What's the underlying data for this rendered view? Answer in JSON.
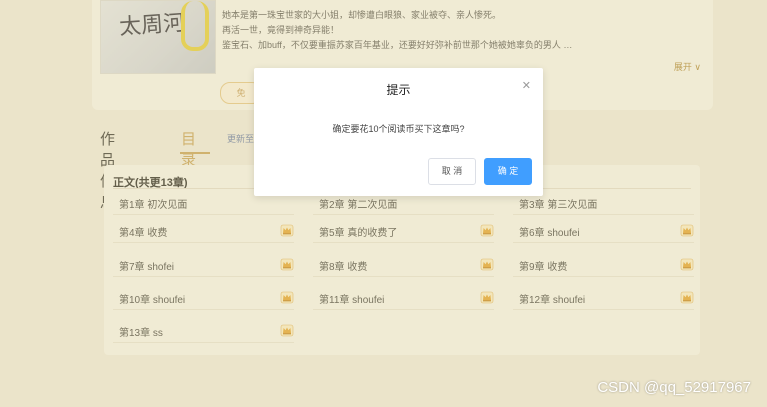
{
  "book": {
    "cover_title": "太周河",
    "description_lines": [
      "她本是第一珠宝世家的大小姐，却惨遭白眼狼、家业被夺、亲人惨死。",
      "再活一世，竟得到神奇异能！",
      "鉴宝石、加buff，不仅要重振苏家百年基业，还要好好弥补前世那个她被她辜负的男人 …"
    ],
    "expand_label": "展开 ∨",
    "free_label": "免"
  },
  "tabs": {
    "info_label": "作品信息",
    "toc_label": "目录",
    "update_label": "更新至"
  },
  "toc": {
    "section_title": "正文(共更13章)",
    "chapters": [
      {
        "label": "第1章 初次见面",
        "locked": false
      },
      {
        "label": "第2章 第二次见面",
        "locked": false
      },
      {
        "label": "第3章 第三次见面",
        "locked": false
      },
      {
        "label": "第4章 收费",
        "locked": true
      },
      {
        "label": "第5章 真的收费了",
        "locked": true
      },
      {
        "label": "第6章 shoufei",
        "locked": true
      },
      {
        "label": "第7章 shofei",
        "locked": true
      },
      {
        "label": "第8章 收费",
        "locked": true
      },
      {
        "label": "第9章 收费",
        "locked": true
      },
      {
        "label": "第10章 shoufei",
        "locked": true
      },
      {
        "label": "第11章 shoufei",
        "locked": true
      },
      {
        "label": "第12章 shoufei",
        "locked": true
      },
      {
        "label": "第13章 ss",
        "locked": true
      }
    ],
    "lock_icon": "crown-icon"
  },
  "dialog": {
    "title": "提示",
    "message": "确定要花10个阅读币买下这章吗?",
    "cancel_label": "取 消",
    "confirm_label": "确 定",
    "close_icon": "close-icon",
    "confirm_color": "#409eff"
  },
  "watermark": "CSDN @qq_52917967",
  "colors": {
    "accent": "#c9a35a",
    "background": "#f3f0e6"
  }
}
